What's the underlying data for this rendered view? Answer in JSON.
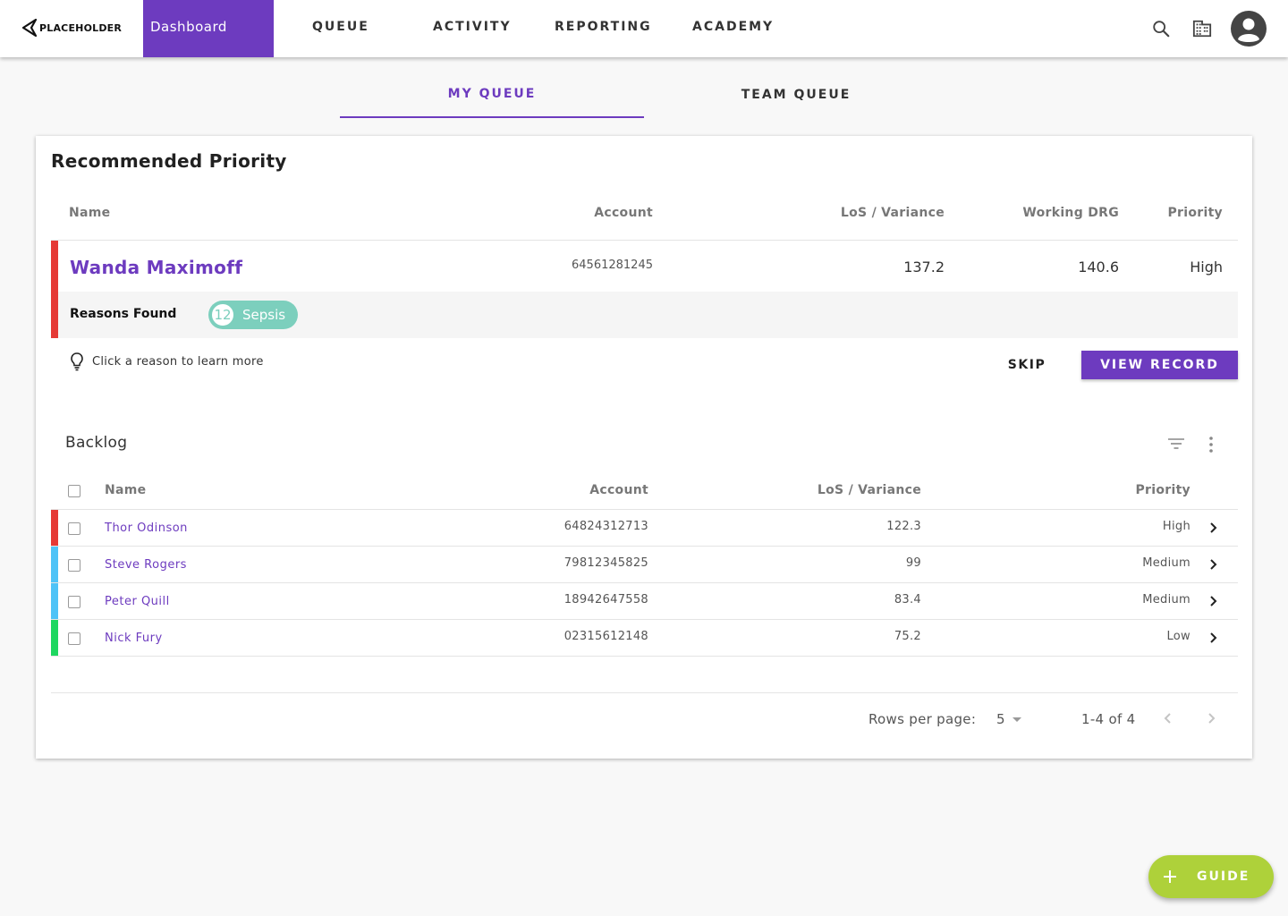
{
  "brand": {
    "name": "PLACEHOLDER"
  },
  "nav": {
    "active": "Dashboard",
    "items": [
      "QUEUE",
      "ACTIVITY",
      "REPORTING",
      "ACADEMY"
    ]
  },
  "tabs": {
    "my_queue": "MY QUEUE",
    "team_queue": "TEAM QUEUE"
  },
  "recommended": {
    "title": "Recommended Priority",
    "headers": {
      "name": "Name",
      "account": "Account",
      "los": "LoS / Variance",
      "drg": "Working DRG",
      "priority": "Priority"
    },
    "patient": {
      "name": "Wanda Maximoff",
      "account": "64561281245",
      "los": "137.2",
      "drg": "140.6",
      "priority": "High",
      "priority_color": "#e53935"
    },
    "reasons_label": "Reasons Found",
    "reason_chip": {
      "count": "12",
      "label": "Sepsis",
      "color": "#7ccfbd"
    },
    "hint": "Click a reason to learn more",
    "skip_label": "SKIP",
    "view_label": "VIEW RECORD"
  },
  "backlog": {
    "title": "Backlog",
    "headers": {
      "name": "Name",
      "account": "Account",
      "los": "LoS / Variance",
      "priority": "Priority"
    },
    "rows": [
      {
        "name": "Thor Odinson",
        "account": "64824312713",
        "los": "122.3",
        "priority": "High",
        "color": "#e53935"
      },
      {
        "name": "Steve Rogers",
        "account": "79812345825",
        "los": "99",
        "priority": "Medium",
        "color": "#4fc3f7"
      },
      {
        "name": "Peter Quill",
        "account": "18942647558",
        "los": "83.4",
        "priority": "Medium",
        "color": "#4fc3f7"
      },
      {
        "name": "Nick Fury",
        "account": "02315612148",
        "los": "75.2",
        "priority": "Low",
        "color": "#1ed760"
      }
    ],
    "pagination": {
      "rows_label": "Rows per page:",
      "rows_value": "5",
      "range": "1-4 of 4"
    }
  },
  "fab": {
    "label": "GUIDE",
    "color": "#aed13a"
  },
  "colors": {
    "accent": "#6d3bbf"
  }
}
